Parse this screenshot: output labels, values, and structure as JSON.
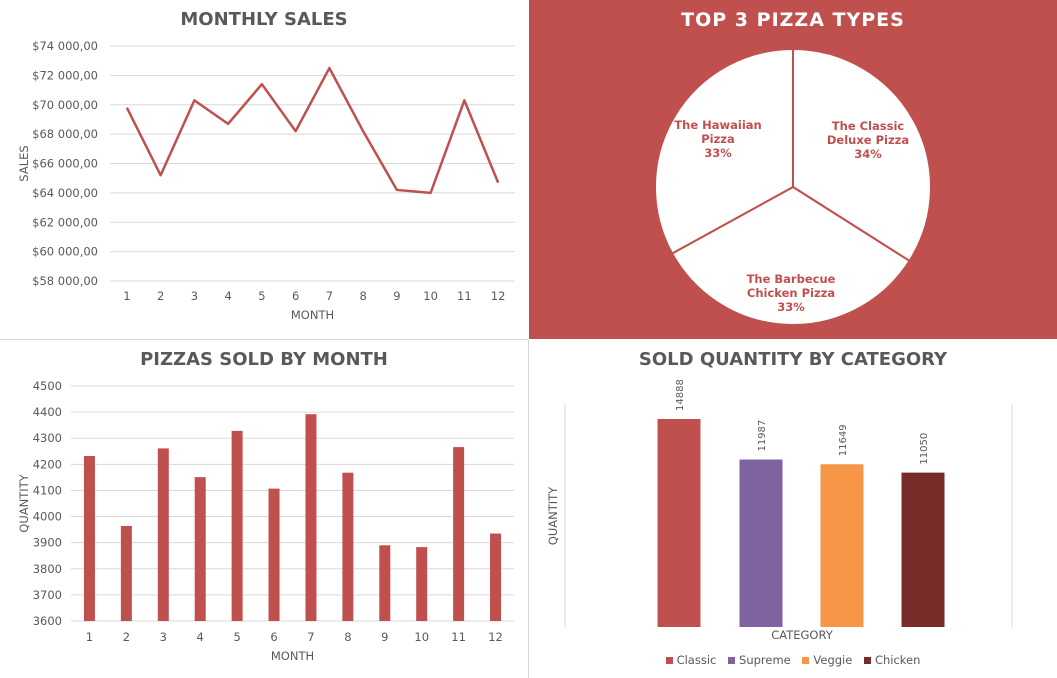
{
  "charts": {
    "monthly_sales": {
      "title": "MONTHLY SALES",
      "xlabel": "MONTH",
      "ylabel": "SALES",
      "color": "#c0504d",
      "yticks": [
        "$74 000,00",
        "$72 000,00",
        "$70 000,00",
        "$68 000,00",
        "$66 000,00",
        "$64 000,00",
        "$62 000,00",
        "$60 000,00",
        "$58 000,00"
      ]
    },
    "top3": {
      "title": "TOP 3 PIZZA TYPES",
      "background": "#c0504d",
      "labels": [
        {
          "l1": "The Classic",
          "l2": "Deluxe Pizza",
          "pct": "34%"
        },
        {
          "l1": "The Barbecue",
          "l2": "Chicken Pizza",
          "pct": "33%"
        },
        {
          "l1": "The Hawaiian",
          "l2": "Pizza",
          "pct": "33%"
        }
      ]
    },
    "pizzas_by_month": {
      "title": "PIZZAS SOLD BY MONTH",
      "xlabel": "MONTH",
      "ylabel": "QUANTITY",
      "color": "#c0504d"
    },
    "by_category": {
      "title": "SOLD QUANTITY BY CATEGORY",
      "xlabel": "CATEGORY",
      "ylabel": "QUANTITY"
    }
  },
  "chart_data": [
    {
      "type": "line",
      "title": "MONTHLY SALES",
      "xlabel": "MONTH",
      "ylabel": "SALES",
      "x": [
        1,
        2,
        3,
        4,
        5,
        6,
        7,
        8,
        9,
        10,
        11,
        12
      ],
      "values": [
        69800,
        65200,
        70300,
        68700,
        71400,
        68200,
        72500,
        68200,
        64200,
        64000,
        70300,
        64700
      ],
      "ylim": [
        58000,
        74000
      ],
      "grid": true
    },
    {
      "type": "pie",
      "title": "TOP 3 PIZZA TYPES",
      "categories": [
        "The Classic Deluxe Pizza",
        "The Barbecue Chicken Pizza",
        "The Hawaiian Pizza"
      ],
      "values": [
        34,
        33,
        33
      ]
    },
    {
      "type": "bar",
      "title": "PIZZAS SOLD BY MONTH",
      "xlabel": "MONTH",
      "ylabel": "QUANTITY",
      "categories": [
        "1",
        "2",
        "3",
        "4",
        "5",
        "6",
        "7",
        "8",
        "9",
        "10",
        "11",
        "12"
      ],
      "values": [
        4232,
        3964,
        4261,
        4151,
        4328,
        4107,
        4392,
        4168,
        3890,
        3883,
        4266,
        3935
      ],
      "ylim": [
        3600,
        4500
      ],
      "yticks": [
        3600,
        3700,
        3800,
        3900,
        4000,
        4100,
        4200,
        4300,
        4400,
        4500
      ],
      "grid": true
    },
    {
      "type": "bar",
      "title": "SOLD QUANTITY BY CATEGORY",
      "xlabel": "CATEGORY",
      "ylabel": "QUANTITY",
      "categories": [
        "Classic",
        "Supreme",
        "Veggie",
        "Chicken"
      ],
      "values": [
        14888,
        11987,
        11649,
        11050
      ],
      "colors": [
        "#c0504d",
        "#8064a2",
        "#f79646",
        "#772c2a"
      ],
      "legend": "bottom"
    }
  ]
}
